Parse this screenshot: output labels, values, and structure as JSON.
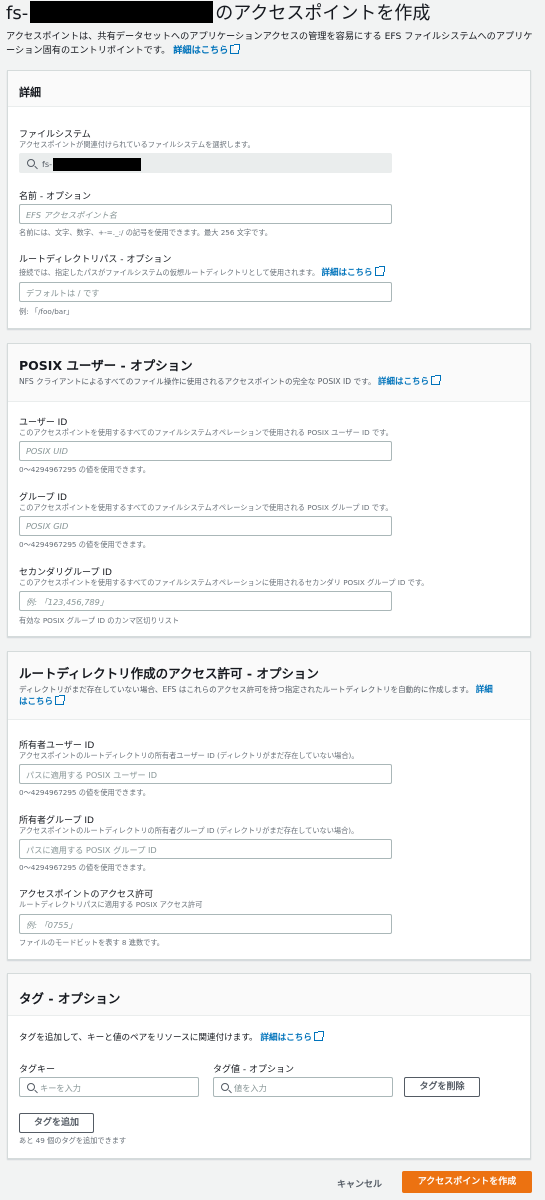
{
  "page": {
    "title_prefix": "fs-",
    "title_suffix": "のアクセスポイントを作成",
    "description": "アクセスポイントは、共有データセットへのアプリケーションアクセスの管理を容易にする EFS ファイルシステムへのアプリケーション固有のエントリポイントです。",
    "learn_more": "詳細はこちら"
  },
  "details": {
    "title": "詳細",
    "filesystem_label": "ファイルシステム",
    "filesystem_desc": "アクセスポイントが関連付けられているファイルシステムを選択します。",
    "filesystem_value": "fs-",
    "name_label": "名前 - オプション",
    "name_placeholder": "EFS アクセスポイント名",
    "name_hint": "名前には、文字、数字、+-=._:/ の記号を使用できます。最大 256 文字です。",
    "rootdir_label": "ルートディレクトリパス - オプション",
    "rootdir_desc": "接続では、指定したパスがファイルシステムの仮想ルートディレクトリとして使用されます。",
    "rootdir_link": "詳細はこちら",
    "rootdir_placeholder": "デフォルトは / です",
    "rootdir_hint": "例: 「/foo/bar」"
  },
  "posix": {
    "title": "POSIX ユーザー - オプション",
    "subtitle": "NFS クライアントによるすべてのファイル操作に使用されるアクセスポイントの完全な POSIX ID です。",
    "link": "詳細はこちら",
    "uid_label": "ユーザー ID",
    "uid_desc": "このアクセスポイントを使用するすべてのファイルシステムオペレーションで使用される POSIX ユーザー ID です。",
    "uid_placeholder": "POSIX UID",
    "uid_hint": "0～4294967295 の値を使用できます。",
    "gid_label": "グループ ID",
    "gid_desc": "このアクセスポイントを使用するすべてのファイルシステムオペレーションで使用される POSIX グループ ID です。",
    "gid_placeholder": "POSIX GID",
    "gid_hint": "0～4294967295 の値を使用できます。",
    "sgid_label": "セカンダリグループ ID",
    "sgid_desc": "このアクセスポイントを使用するすべてのファイルシステムオペレーションに使用されるセカンダリ POSIX グループ ID です。",
    "sgid_placeholder": "例: 「123,456,789」",
    "sgid_hint": "有効な POSIX グループ ID のカンマ区切りリスト"
  },
  "permissions": {
    "title": "ルートディレクトリ作成のアクセス許可 - オプション",
    "subtitle": "ディレクトリがまだ存在していない場合、EFS はこれらのアクセス許可を持つ指定されたルートディレクトリを自動的に作成します。",
    "link_part1": "詳細",
    "link_part2": "はこちら",
    "owner_uid_label": "所有者ユーザー ID",
    "owner_uid_desc": "アクセスポイントのルートディレクトリの所有者ユーザー ID (ディレクトリがまだ存在していない場合)。",
    "owner_uid_placeholder": "パスに適用する POSIX ユーザー ID",
    "owner_uid_hint": "0～4294967295 の値を使用できます。",
    "owner_gid_label": "所有者グループ ID",
    "owner_gid_desc": "アクセスポイントのルートディレクトリの所有者グループ ID (ディレクトリがまだ存在していない場合)。",
    "owner_gid_placeholder": "パスに適用する POSIX グループ ID",
    "owner_gid_hint": "0～4294967295 の値を使用できます。",
    "perm_label": "アクセスポイントのアクセス許可",
    "perm_desc": "ルートディレクトリパスに適用する POSIX アクセス許可",
    "perm_placeholder": "例: 「0755」",
    "perm_hint": "ファイルのモードビットを表す 8 進数です。"
  },
  "tags": {
    "title": "タグ - オプション",
    "subtitle": "タグを追加して、キーと値のペアをリソースに関連付けます。",
    "link": "詳細はこちら",
    "key_label": "タグキー",
    "key_placeholder": "キーを入力",
    "value_label": "タグ値 - オプション",
    "value_placeholder": "値を入力",
    "remove_button": "タグを削除",
    "add_button": "タグを追加",
    "remaining": "あと 49 個のタグを追加できます"
  },
  "footer": {
    "cancel": "キャンセル",
    "create": "アクセスポイントを作成"
  },
  "colors": {
    "link": "#0073bb",
    "primary": "#ec7211",
    "background": "#f2f3f3"
  }
}
